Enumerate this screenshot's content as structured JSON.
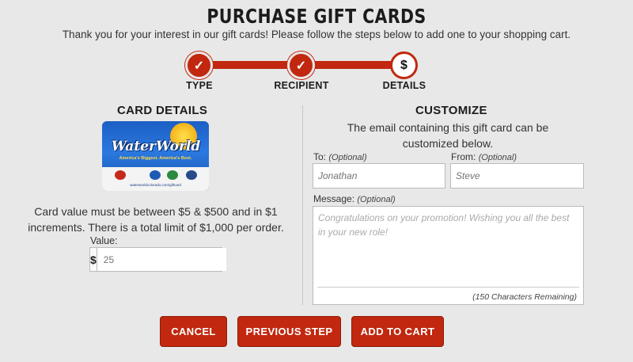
{
  "header": {
    "title": "PURCHASE GIFT CARDS",
    "subtitle": "Thank you for your interest in our gift cards! Please follow the steps below to add one to your shopping cart."
  },
  "stepper": {
    "steps": [
      {
        "label": "TYPE",
        "icon": "check-icon",
        "glyph": "✓",
        "state": "done"
      },
      {
        "label": "RECIPIENT",
        "icon": "check-icon",
        "glyph": "✓",
        "state": "done"
      },
      {
        "label": "DETAILS",
        "icon": "dollar-icon",
        "glyph": "$",
        "state": "active"
      }
    ]
  },
  "card_details": {
    "title": "CARD DETAILS",
    "card_image": {
      "logo": "WaterWorld",
      "tagline": "America's Biggest. America's Best.",
      "url": "waterworldcolorado.com/giftcard"
    },
    "info": "Card value must be between $5 & $500 and in $1 increments. There is a total limit of $1,000 per order.",
    "value_label": "Value:",
    "currency_symbol": "$",
    "value_placeholder": "25"
  },
  "customize": {
    "title": "CUSTOMIZE",
    "description": "The email containing this gift card can be customized below.",
    "to_label": "To:",
    "to_optional": "(Optional)",
    "to_placeholder": "Jonathan",
    "from_label": "From:",
    "from_optional": "(Optional)",
    "from_placeholder": "Steve",
    "message_label": "Message:",
    "message_optional": "(Optional)",
    "message_placeholder": "Congratulations on your promotion! Wishing you all the best in your new role!",
    "remaining": "(150 Characters Remaining)"
  },
  "buttons": {
    "cancel": "CANCEL",
    "previous": "PREVIOUS STEP",
    "add_to_cart": "ADD TO CART"
  },
  "colors": {
    "accent": "#c1280f",
    "background": "#e8e8e8"
  }
}
